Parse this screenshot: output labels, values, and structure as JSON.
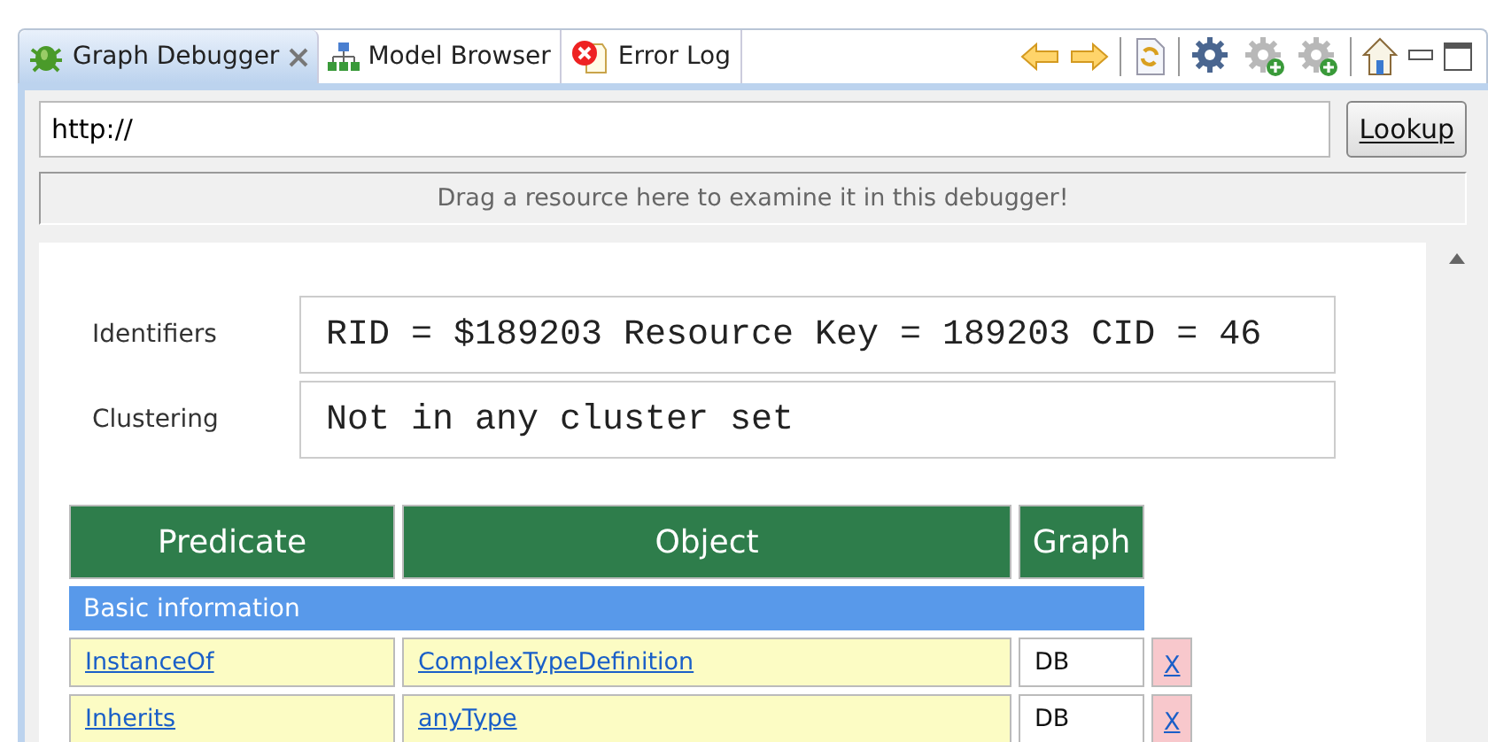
{
  "tabs": [
    {
      "label": "Graph Debugger",
      "selected": true,
      "closable": true,
      "kind": "bug"
    },
    {
      "label": "Model Browser",
      "selected": false,
      "closable": false,
      "kind": "tree"
    },
    {
      "label": "Error Log",
      "selected": false,
      "closable": false,
      "kind": "error"
    }
  ],
  "address": {
    "value": "http://",
    "button": "Lookup"
  },
  "drop_hint": "Drag a resource here to examine it in this debugger!",
  "properties": [
    {
      "label": "Identifiers",
      "value": "RID = $189203 Resource Key = 189203 CID = 46"
    },
    {
      "label": "Clustering",
      "value": "Not in any cluster set"
    }
  ],
  "table": {
    "columns": [
      "Predicate",
      "Object",
      "Graph"
    ],
    "sections": [
      {
        "title": "Basic information",
        "rows": [
          {
            "predicate": "InstanceOf",
            "object": "ComplexTypeDefinition",
            "graph": "DB",
            "remove": "X"
          },
          {
            "predicate": "Inherits",
            "object": "anyType",
            "graph": "DB",
            "remove": "X"
          }
        ]
      }
    ]
  }
}
